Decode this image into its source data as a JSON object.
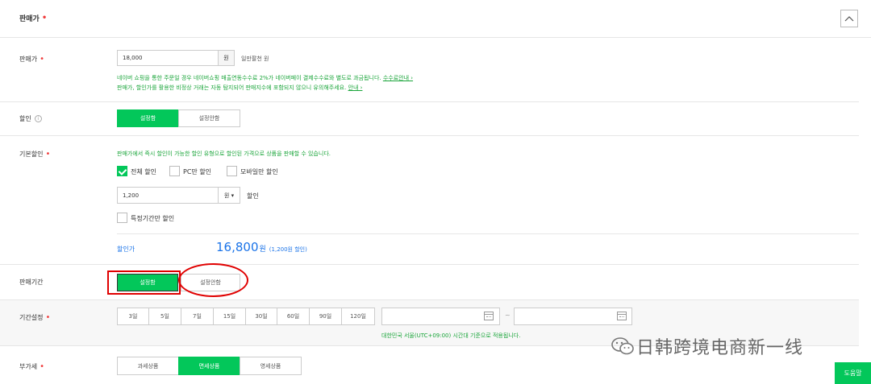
{
  "section": {
    "title": "판매가",
    "collapse_icon": "chevron-up-icon"
  },
  "price": {
    "label": "판매가",
    "value": "18,000",
    "unit": "원",
    "hangul": "일만팔천 원",
    "notice1": "네이버 쇼핑을 통한 주문일 경우 네이버쇼핑 매출연동수수료 2%가 네이버페이 결제수수료와 별도로 과금됩니다.",
    "notice1_link": "수수료안내 ›",
    "notice2": "판매가, 할인가를 활용한 비정상 거래는 자동 탐지되어 판매지수에 포함되지 않으니 유의해주세요.",
    "notice2_link": "안내 ›"
  },
  "discount": {
    "label": "할인",
    "info_icon": "info-icon",
    "on_label": "설정함",
    "off_label": "설정안함"
  },
  "basic_discount": {
    "label": "기본할인",
    "desc": "판매가에서 즉시 할인이 가능한 할인 유형으로 할인된 가격으로 상품을 판매할 수 있습니다.",
    "opt_all": "전체 할인",
    "opt_pc": "PC만 할인",
    "opt_mobile": "모바일만 할인",
    "value": "1,200",
    "unit_select": "원 ▾",
    "unit_suffix": "할인",
    "period_only": "특정기간만 할인",
    "result_label": "할인가",
    "result_price": "16,800",
    "result_won": "원",
    "result_note": "(1,200원 할인)"
  },
  "sale_period": {
    "label": "판매기간",
    "on_label": "설정함",
    "off_label": "설정안함"
  },
  "period_setting": {
    "label": "기간설정",
    "days": [
      "3일",
      "5일",
      "7일",
      "15일",
      "30일",
      "60일",
      "90일",
      "120일"
    ],
    "dash": "~",
    "timezone_note": "대한민국 서울(UTC+09:00) 시간대 기준으로 적용됩니다."
  },
  "vat": {
    "label": "부가세",
    "options": [
      "과세상품",
      "면세상품",
      "영세상품"
    ]
  },
  "watermark": "日韩跨境电商新一线",
  "help_button": "도움말",
  "colors": {
    "accent": "#03c75a",
    "required": "#f03c3c",
    "link_blue": "#1a73e8",
    "highlight_red": "#e00000"
  }
}
